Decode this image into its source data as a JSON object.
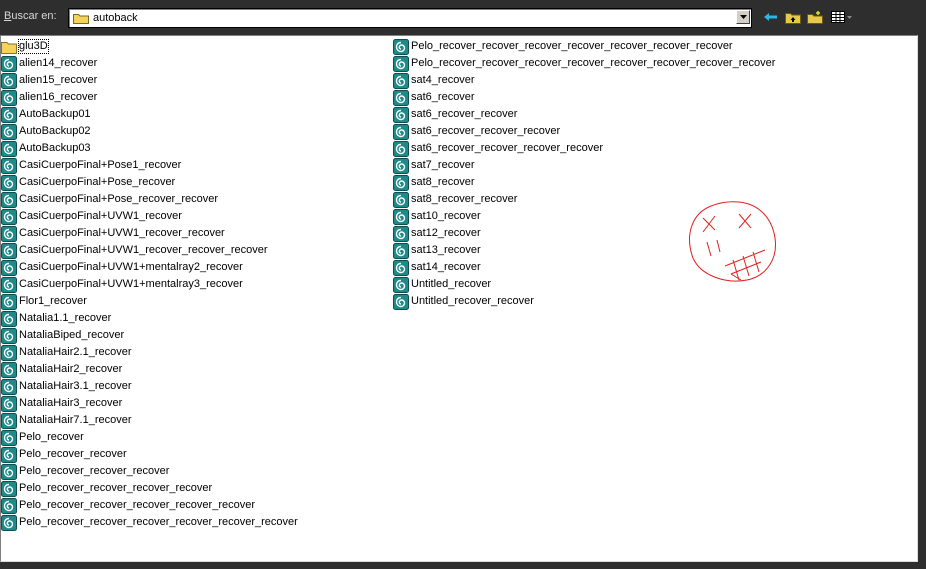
{
  "toolbar": {
    "lookin_label_accel": "B",
    "lookin_label_rest": "uscar en:",
    "current_folder": "autoback"
  },
  "files": {
    "column1": [
      {
        "name": "glu3D",
        "type": "folder"
      },
      {
        "name": "alien14_recover",
        "type": "max"
      },
      {
        "name": "alien15_recover",
        "type": "max"
      },
      {
        "name": "alien16_recover",
        "type": "max"
      },
      {
        "name": "AutoBackup01",
        "type": "max"
      },
      {
        "name": "AutoBackup02",
        "type": "max"
      },
      {
        "name": "AutoBackup03",
        "type": "max"
      },
      {
        "name": "CasiCuerpoFinal+Pose1_recover",
        "type": "max"
      },
      {
        "name": "CasiCuerpoFinal+Pose_recover",
        "type": "max"
      },
      {
        "name": "CasiCuerpoFinal+Pose_recover_recover",
        "type": "max"
      },
      {
        "name": "CasiCuerpoFinal+UVW1_recover",
        "type": "max"
      },
      {
        "name": "CasiCuerpoFinal+UVW1_recover_recover",
        "type": "max"
      },
      {
        "name": "CasiCuerpoFinal+UVW1_recover_recover_recover",
        "type": "max"
      },
      {
        "name": "CasiCuerpoFinal+UVW1+mentalray2_recover",
        "type": "max"
      },
      {
        "name": "CasiCuerpoFinal+UVW1+mentalray3_recover",
        "type": "max"
      },
      {
        "name": "Flor1_recover",
        "type": "max"
      },
      {
        "name": "Natalia1.1_recover",
        "type": "max"
      },
      {
        "name": "NataliaBiped_recover",
        "type": "max"
      },
      {
        "name": "NataliaHair2.1_recover",
        "type": "max"
      },
      {
        "name": "NataliaHair2_recover",
        "type": "max"
      },
      {
        "name": "NataliaHair3.1_recover",
        "type": "max"
      },
      {
        "name": "NataliaHair3_recover",
        "type": "max"
      },
      {
        "name": "NataliaHair7.1_recover",
        "type": "max"
      },
      {
        "name": "Pelo_recover",
        "type": "max"
      },
      {
        "name": "Pelo_recover_recover",
        "type": "max"
      },
      {
        "name": "Pelo_recover_recover_recover",
        "type": "max"
      },
      {
        "name": "Pelo_recover_recover_recover_recover",
        "type": "max"
      },
      {
        "name": "Pelo_recover_recover_recover_recover_recover",
        "type": "max"
      },
      {
        "name": "Pelo_recover_recover_recover_recover_recover_recover",
        "type": "max"
      }
    ],
    "column2": [
      {
        "name": "Pelo_recover_recover_recover_recover_recover_recover_recover",
        "type": "max"
      },
      {
        "name": "Pelo_recover_recover_recover_recover_recover_recover_recover_recover",
        "type": "max"
      },
      {
        "name": "sat4_recover",
        "type": "max"
      },
      {
        "name": "sat6_recover",
        "type": "max"
      },
      {
        "name": "sat6_recover_recover",
        "type": "max"
      },
      {
        "name": "sat6_recover_recover_recover",
        "type": "max"
      },
      {
        "name": "sat6_recover_recover_recover_recover",
        "type": "max"
      },
      {
        "name": "sat7_recover",
        "type": "max"
      },
      {
        "name": "sat8_recover",
        "type": "max"
      },
      {
        "name": "sat8_recover_recover",
        "type": "max"
      },
      {
        "name": "sat10_recover",
        "type": "max"
      },
      {
        "name": "sat12_recover",
        "type": "max"
      },
      {
        "name": "sat13_recover",
        "type": "max"
      },
      {
        "name": "sat14_recover",
        "type": "max"
      },
      {
        "name": "Untitled_recover",
        "type": "max"
      },
      {
        "name": "Untitled_recover_recover",
        "type": "max"
      }
    ]
  },
  "colors": {
    "background": "#2e2e2e",
    "panel": "#ffffff",
    "max_icon_teal": "#1f8a8a",
    "folder_yellow": "#f3d35c",
    "doodle_red": "#e02020"
  }
}
